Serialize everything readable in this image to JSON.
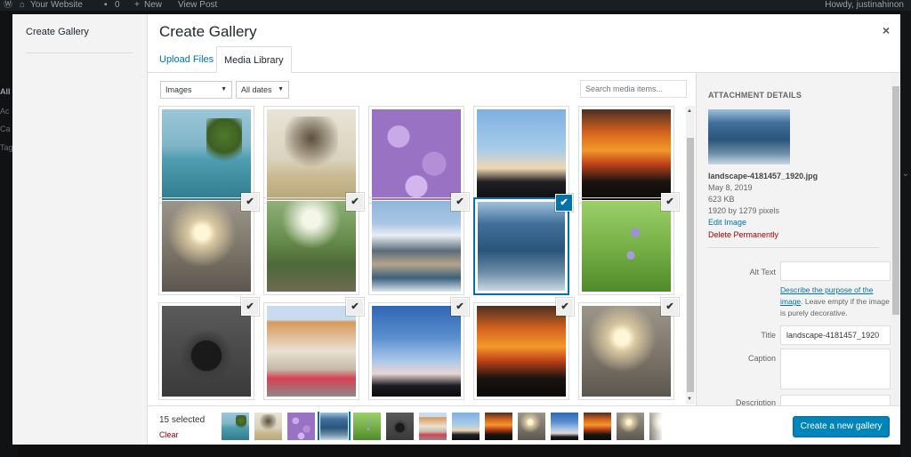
{
  "admin_bar": {
    "site": "Your Website",
    "comments": "0",
    "new": "New",
    "view": "View Post",
    "howdy": "Howdy, justinahinon"
  },
  "admin_menu_fragments": [
    "All",
    "Ac",
    "Ca",
    "Tag"
  ],
  "modal": {
    "menu_item": "Create Gallery",
    "title": "Create Gallery",
    "close_icon": "×"
  },
  "tabs": [
    {
      "label": "Upload Files",
      "active": false
    },
    {
      "label": "Media Library",
      "active": true
    }
  ],
  "filters": {
    "type": "Images",
    "date": "All dates",
    "search_placeholder": "Search media items..."
  },
  "grid": [
    {
      "image": "lake-tree",
      "checked": false
    },
    {
      "image": "bare-tree",
      "checked": false
    },
    {
      "image": "purple-flowers",
      "checked": false
    },
    {
      "image": "sunset-clouds",
      "checked": false
    },
    {
      "image": "orange-sunset",
      "checked": false
    },
    {
      "image": "hazy-sun",
      "checked": true
    },
    {
      "image": "forest-stairs",
      "checked": true
    },
    {
      "image": "snowy-mountain",
      "checked": true
    },
    {
      "image": "misty-forest",
      "checked": true,
      "active": true
    },
    {
      "image": "meadow-flowers",
      "checked": true
    },
    {
      "image": "wristwatch",
      "checked": true
    },
    {
      "image": "shop-vw-beetle",
      "checked": true
    },
    {
      "image": "blue-sky-dusk",
      "checked": true
    },
    {
      "image": "orange-sunset",
      "checked": true
    },
    {
      "image": "hazy-sun",
      "checked": true
    }
  ],
  "check_icon": "✔",
  "details": {
    "heading": "ATTACHMENT DETAILS",
    "filename": "landscape-4181457_1920.jpg",
    "date": "May 8, 2019",
    "size": "623 KB",
    "dimensions": "1920 by 1279 pixels",
    "edit": "Edit Image",
    "delete": "Delete Permanently",
    "alt_label": "Alt Text",
    "alt_value": "",
    "help_link": "Describe the purpose of the image",
    "help_text": ". Leave empty if the image is purely decorative.",
    "title_label": "Title",
    "title_value": "landscape-4181457_1920",
    "caption_label": "Caption",
    "description_label": "Description"
  },
  "footer": {
    "count": "15 selected",
    "clear": "Clear",
    "create_button": "Create a new gallery"
  },
  "selection_strip": [
    "lake-tree",
    "bare-tree",
    "purple-flowers",
    "misty-forest",
    "meadow-flowers",
    "wristwatch",
    "shop-vw-beetle",
    "sunset-clouds",
    "orange-sunset",
    "hazy-sun",
    "blue-sky-dusk",
    "orange-sunset",
    "hazy-sun",
    "hazy-sun"
  ]
}
